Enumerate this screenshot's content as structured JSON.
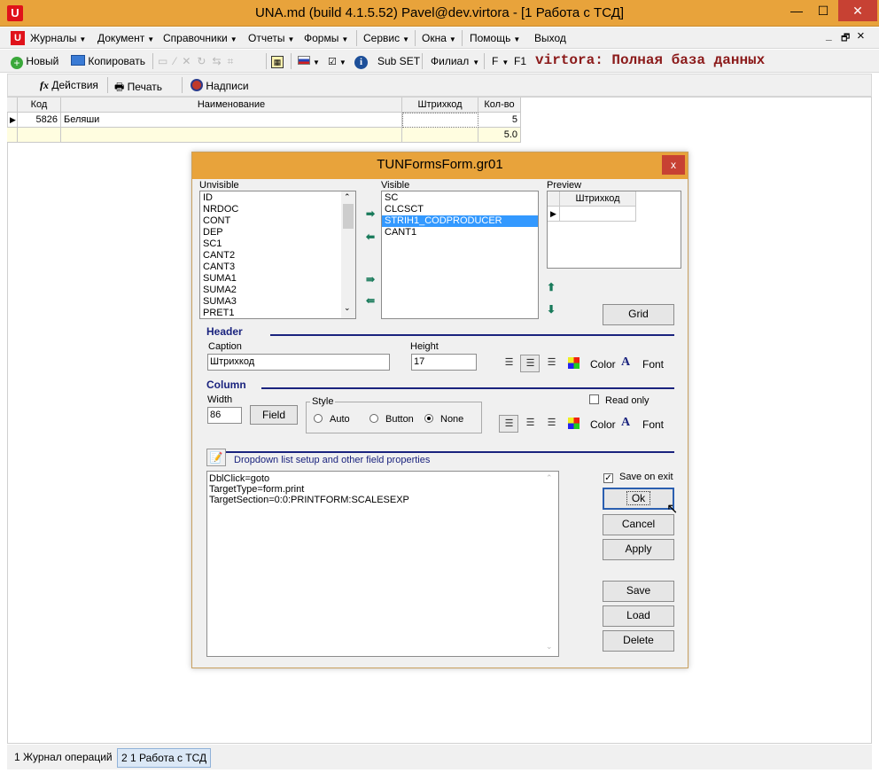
{
  "window": {
    "title": "UNA.md (build 4.1.5.52) Pavel@dev.virtora - [1 Работа с ТСД]",
    "minimize": "—",
    "maximize": "☐",
    "close": "✕"
  },
  "menu": {
    "journals": "Журналы",
    "document": "Документ",
    "directories": "Справочники",
    "reports": "Отчеты",
    "forms": "Формы",
    "service": "Сервис",
    "windows": "Окна",
    "help": "Помощь",
    "exit": "Выход",
    "mdi_min": "_",
    "mdi_restore": "🗗",
    "mdi_close": "×"
  },
  "toolbar": {
    "new": "Новый",
    "copy": "Копировать",
    "sub_set": "Sub SET",
    "branch": "Филиал",
    "f": "F",
    "f1": "F1",
    "db_banner": "virtora: Полная база данных"
  },
  "subbar": {
    "actions": "Действия",
    "print": "Печать",
    "labels": "Надписи"
  },
  "grid": {
    "headers": [
      "Код",
      "Наименование",
      "Штрихкод",
      "Кол-во"
    ],
    "rows": [
      {
        "code": "5826",
        "name": "Беляши",
        "barcode": "",
        "qty": "5"
      }
    ],
    "total": "5.0"
  },
  "dialog": {
    "title": "TUNFormsForm.gr01",
    "close": "x",
    "unvisible_label": "Unvisible",
    "visible_label": "Visible",
    "preview_label": "Preview",
    "unvisible_items": [
      "ID",
      "NRDOC",
      "CONT",
      "DEP",
      "SC1",
      "CANT2",
      "CANT3",
      "SUMA1",
      "SUMA2",
      "SUMA3",
      "PRET1"
    ],
    "visible_items": [
      "SC",
      "CLCSCT",
      "STRIH1_CODPRODUCER",
      "CANT1"
    ],
    "selected_visible": "STRIH1_CODPRODUCER",
    "preview_header": "Штрихкод",
    "grid_button": "Grid",
    "header_section": "Header",
    "caption_label": "Caption",
    "caption_value": "Штрихкод",
    "height_label": "Height",
    "height_value": "17",
    "color_label": "Color",
    "font_label": "Font",
    "column_section": "Column",
    "width_label": "Width",
    "width_value": "86",
    "field_button": "Field",
    "style_label": "Style",
    "style_auto": "Auto",
    "style_button": "Button",
    "style_none": "None",
    "style_selected": "None",
    "read_only_label": "Read only",
    "read_only_checked": false,
    "props_label": "Dropdown list setup and other field properties",
    "props_lines": [
      "DblClick=goto",
      "TargetType=form.print",
      "TargetSection=0:0:PRINTFORM:SCALESEXP"
    ],
    "save_on_exit_label": "Save on exit",
    "save_on_exit_checked": true,
    "ok": "Ok",
    "cancel": "Cancel",
    "apply": "Apply",
    "save": "Save",
    "load": "Load",
    "delete": "Delete"
  },
  "status_tabs": [
    "1 Журнал операций",
    "2 1 Работа с ТСД"
  ],
  "colors": {
    "titlebar": "#e8a33b",
    "close_button": "#c74133",
    "selection": "#3399ff",
    "section_blue": "#1a237e",
    "banner_red": "#8b1a1a"
  }
}
